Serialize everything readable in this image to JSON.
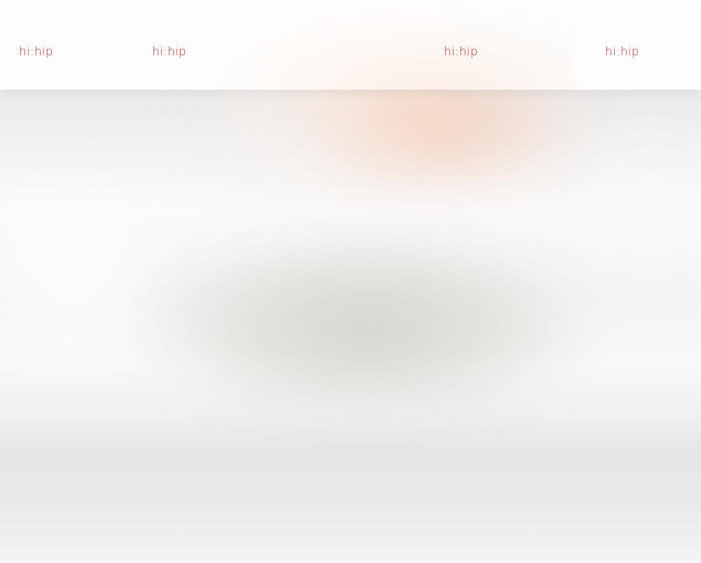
{
  "header": {
    "logos": [
      {
        "text": "hi:hip"
      },
      {
        "text": "hi:hip"
      },
      {
        "text": "hi:hip"
      },
      {
        "text": "hi:hip"
      }
    ]
  },
  "colors": {
    "brand": "#e3262b",
    "header_background": "#ffffff",
    "page_background": "#ececec"
  }
}
